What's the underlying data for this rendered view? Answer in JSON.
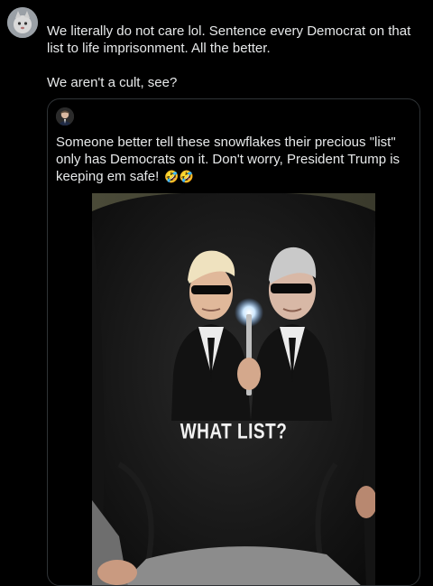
{
  "post": {
    "avatar_icon": "cat-avatar",
    "text_line1": "We literally do not care lol. Sentence every Democrat on that list to life imprisonment. All the better.",
    "text_line2": "We aren't a cult, see?"
  },
  "quoted_post": {
    "avatar_icon": "user-photo-avatar",
    "text": "Someone better tell these snowflakes their precious \"list\" only has Democrats on it. Don't worry, President Trump is keeping em safe!",
    "emojis": "🤣🤣",
    "image": {
      "description_icon": "photo-sweatshirt",
      "shirt_text": "WHAT LIST?"
    }
  },
  "colors": {
    "background": "#000000",
    "text": "#e7e9ea",
    "border": "#2f3336"
  }
}
